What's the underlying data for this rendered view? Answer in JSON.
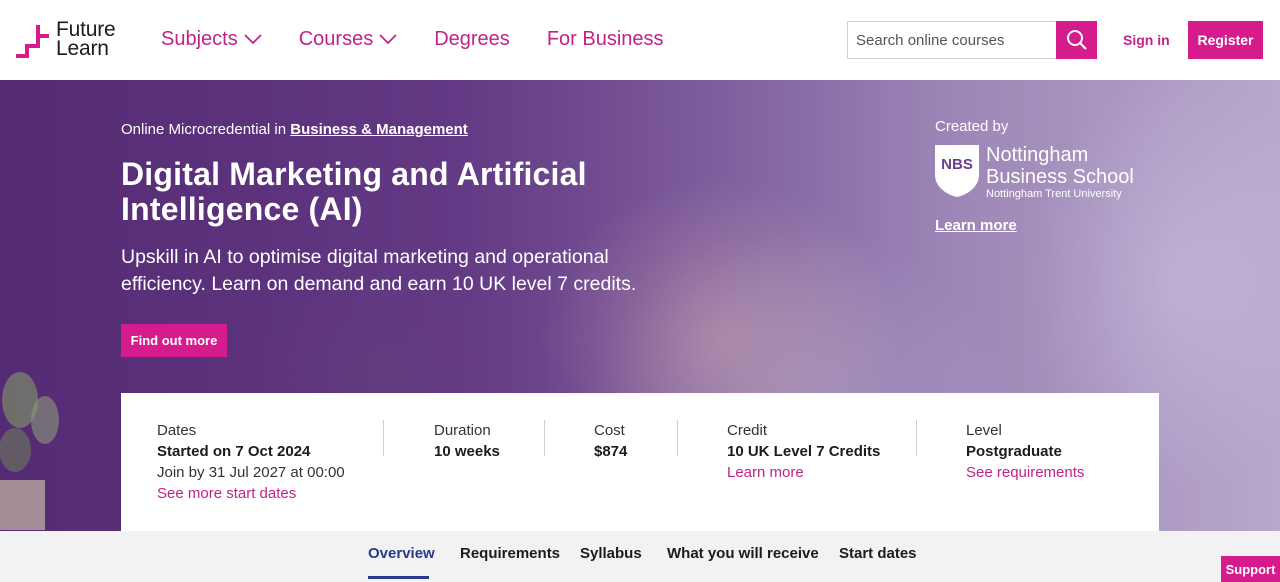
{
  "header": {
    "logo_line1": "Future",
    "logo_line2": "Learn",
    "nav": [
      {
        "label": "Subjects"
      },
      {
        "label": "Courses"
      },
      {
        "label": "Degrees"
      },
      {
        "label": "For Business"
      }
    ],
    "search_placeholder": "Search online courses",
    "signin_label": "Sign in",
    "register_label": "Register"
  },
  "hero": {
    "eyebrow_prefix": "Online Microcredential in",
    "eyebrow_link": "Business & Management",
    "title": "Digital Marketing and Artificial Intelligence (AI)",
    "subtitle": "Upskill in AI to optimise digital marketing and operational efficiency. Learn on demand and earn 10 UK level 7 credits.",
    "cta_label": "Find out more",
    "created_by_label": "Created by",
    "partner": {
      "shield_text": "NBS",
      "line1": "Nottingham",
      "line2": "Business School",
      "line3": "Nottingham Trent University"
    },
    "partner_link": "Learn more"
  },
  "info": {
    "dates": {
      "label": "Dates",
      "value": "Started on 7 Oct 2024",
      "note": "Join by 31 Jul 2027 at 00:00",
      "link": "See more start dates"
    },
    "duration": {
      "label": "Duration",
      "value": "10 weeks"
    },
    "cost": {
      "label": "Cost",
      "value": "$874"
    },
    "credit": {
      "label": "Credit",
      "value": "10 UK Level 7 Credits",
      "link": "Learn more"
    },
    "level": {
      "label": "Level",
      "value": "Postgraduate",
      "link": "See requirements"
    }
  },
  "tabs": [
    {
      "label": "Overview"
    },
    {
      "label": "Requirements"
    },
    {
      "label": "Syllabus"
    },
    {
      "label": "What you will receive"
    },
    {
      "label": "Start dates"
    }
  ],
  "support_label": "Support",
  "colors": {
    "brand_pink": "#d61b8c",
    "link_pink": "#c0238a",
    "active_tab": "#2a3a8a"
  }
}
